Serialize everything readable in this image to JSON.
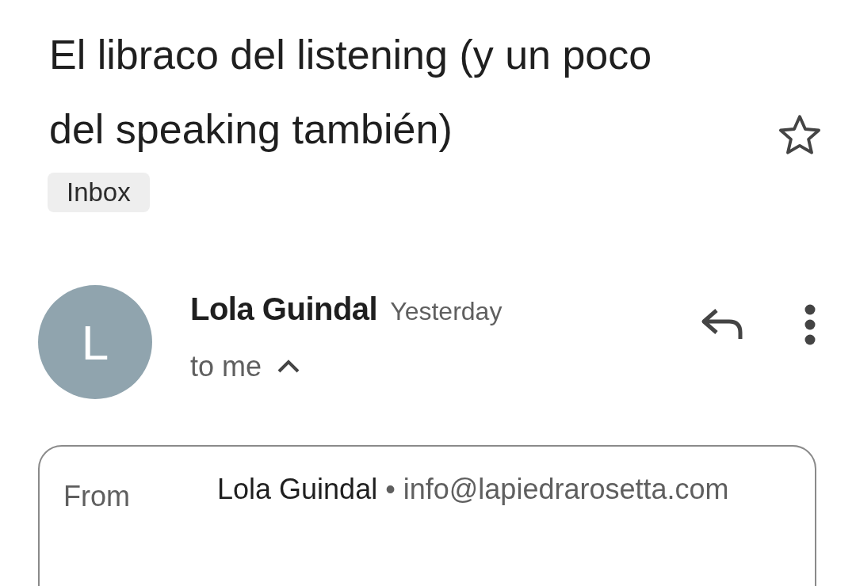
{
  "subject": "El libraco del listening (y un poco del speaking también)",
  "starred": false,
  "label": "Inbox",
  "message": {
    "avatar_letter": "L",
    "sender": "Lola Guindal",
    "time": "Yesterday",
    "recipients": "to me",
    "details_expanded": true
  },
  "details": [
    {
      "label": "From",
      "name": "Lola Guindal",
      "separator": "•",
      "email": "info@lapiedrarosetta.com"
    }
  ]
}
